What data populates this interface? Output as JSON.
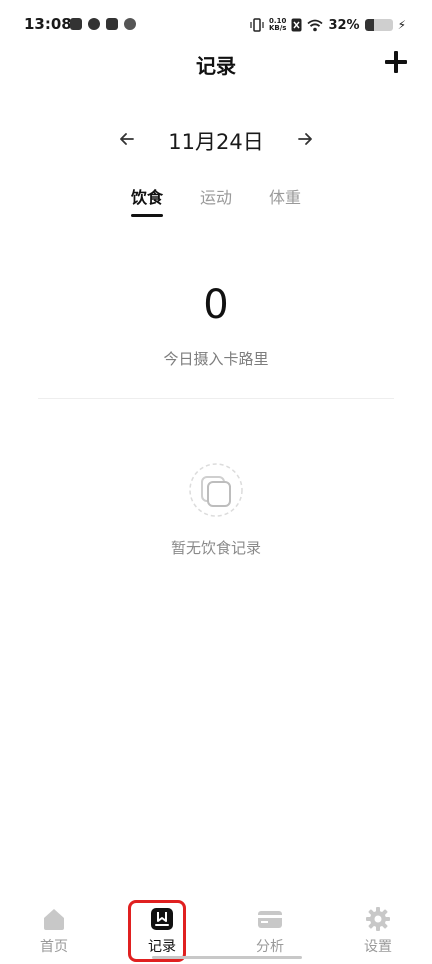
{
  "status_bar": {
    "time": "13:08",
    "net_speed_value": "0.10",
    "net_speed_unit": "KB/s",
    "battery_percent_text": "32%",
    "battery_level": 0.32,
    "icons": [
      "mail-icon",
      "check-circle-icon",
      "message-icon",
      "wechat-icon",
      "vibrate-icon",
      "sim-icon",
      "wifi-icon",
      "battery-icon",
      "charging-icon"
    ]
  },
  "header": {
    "title": "记录",
    "add_icon": "plus-icon"
  },
  "date_nav": {
    "prev_icon": "arrow-left-icon",
    "date": "11月24日",
    "next_icon": "arrow-right-icon"
  },
  "tabs": [
    {
      "label": "饮食",
      "active": true
    },
    {
      "label": "运动",
      "active": false
    },
    {
      "label": "体重",
      "active": false
    }
  ],
  "summary": {
    "calories": "0",
    "calories_label": "今日摄入卡路里"
  },
  "empty_state": {
    "icon": "empty-copy-icon",
    "text": "暂无饮食记录"
  },
  "bottom_nav": [
    {
      "label": "首页",
      "icon": "home-icon",
      "active": false
    },
    {
      "label": "记录",
      "icon": "book-icon",
      "active": true
    },
    {
      "label": "分析",
      "icon": "card-analysis-icon",
      "active": false
    },
    {
      "label": "设置",
      "icon": "gear-icon",
      "active": false
    }
  ],
  "colors": {
    "text_primary": "#111111",
    "text_secondary": "#9a9a9a",
    "highlight": "#e02020",
    "background": "#ffffff"
  }
}
